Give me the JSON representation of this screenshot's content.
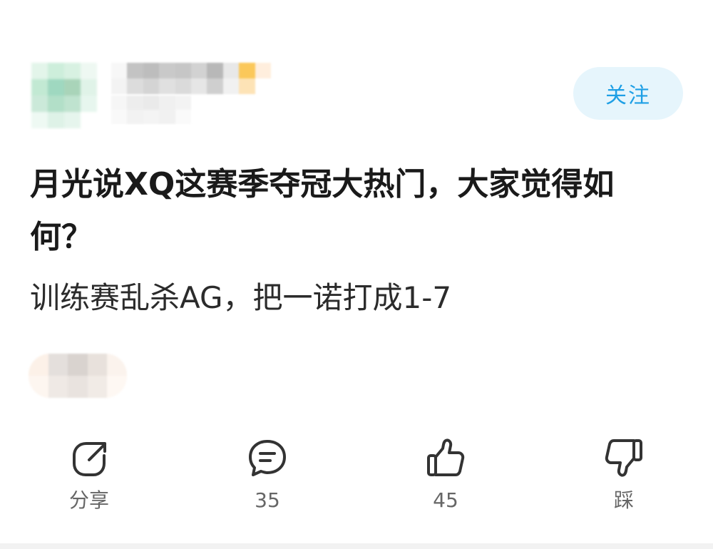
{
  "header": {
    "follow_label": "关注"
  },
  "post": {
    "title": "月光说XQ这赛季夺冠大热门，大家觉得如何？",
    "body": "训练赛乱杀AG，把一诺打成1-7"
  },
  "actions": [
    {
      "icon": "share-icon",
      "label": "分享"
    },
    {
      "icon": "comment-icon",
      "label": "35"
    },
    {
      "icon": "thumbs-up-icon",
      "label": "45"
    },
    {
      "icon": "thumbs-down-icon",
      "label": "踩"
    }
  ],
  "colors": {
    "accent": "#1e9fe5",
    "follow_bg": "#e6f5fc",
    "title": "#1a1a1a",
    "secondary_text": "#666666",
    "icon_stroke": "#333333"
  }
}
